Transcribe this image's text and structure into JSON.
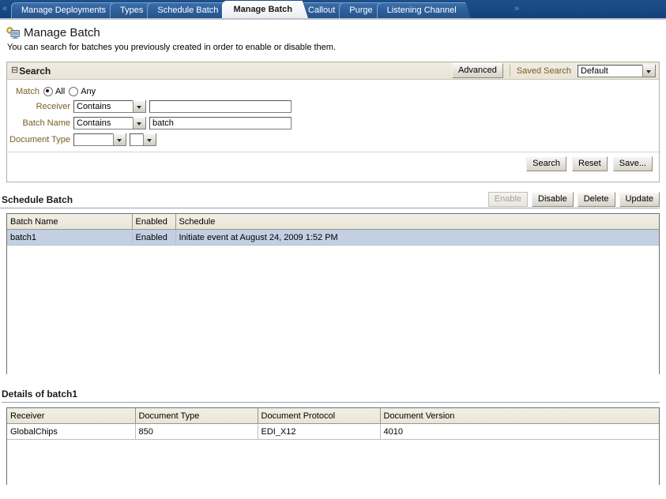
{
  "tabbar": {
    "scroll_left_icon": "chevron-left-double",
    "scroll_right_icon": "chevron-right-double",
    "scroll_left": "«",
    "scroll_right": "»",
    "tabs": [
      {
        "label": "Manage Deployments",
        "active": false
      },
      {
        "label": "Types",
        "active": false
      },
      {
        "label": "Schedule Batch",
        "active": false
      },
      {
        "label": "Manage Batch",
        "active": true
      },
      {
        "label": "Callout",
        "active": false
      },
      {
        "label": "Purge",
        "active": false
      },
      {
        "label": "Listening Channel",
        "active": false
      }
    ]
  },
  "page": {
    "icon": "monitor-search-icon",
    "title": "Manage Batch",
    "subtitle": "You can search for batches you previously created in order to enable or disable them."
  },
  "search": {
    "collapse_icon": "⊟",
    "title": "Search",
    "advanced_label": "Advanced",
    "saved_search_label": "Saved Search",
    "saved_search_value": "Default",
    "match_label": "Match",
    "match_options": [
      {
        "label": "All",
        "selected": true
      },
      {
        "label": "Any",
        "selected": false
      }
    ],
    "fields": [
      {
        "label": "Receiver",
        "operator": "Contains",
        "value": "",
        "placeholder": ""
      },
      {
        "label": "Batch Name",
        "operator": "Contains",
        "value": "batch",
        "placeholder": ""
      }
    ],
    "document_type": {
      "label": "Document Type",
      "value1": "",
      "value2": ""
    },
    "actions": [
      {
        "label": "Search",
        "disabled": false
      },
      {
        "label": "Reset",
        "disabled": false
      },
      {
        "label": "Save...",
        "disabled": false
      }
    ]
  },
  "schedule_batch": {
    "title": "Schedule Batch",
    "actions": [
      {
        "label": "Enable",
        "disabled": true
      },
      {
        "label": "Disable",
        "disabled": false
      },
      {
        "label": "Delete",
        "disabled": false
      },
      {
        "label": "Update",
        "disabled": false
      }
    ],
    "columns": [
      "Batch Name",
      "Enabled",
      "Schedule"
    ],
    "rows": [
      {
        "batch_name": "batch1",
        "enabled": "Enabled",
        "schedule": "Initiate event at August 24, 2009 1:52 PM",
        "selected": true
      }
    ]
  },
  "details": {
    "title": "Details of batch1",
    "columns": [
      "Receiver",
      "Document Type",
      "Document Protocol",
      "Document Version"
    ],
    "rows": [
      {
        "receiver": "GlobalChips",
        "document_type": "850",
        "document_protocol": "EDI_X12",
        "document_version": "4010"
      }
    ]
  }
}
